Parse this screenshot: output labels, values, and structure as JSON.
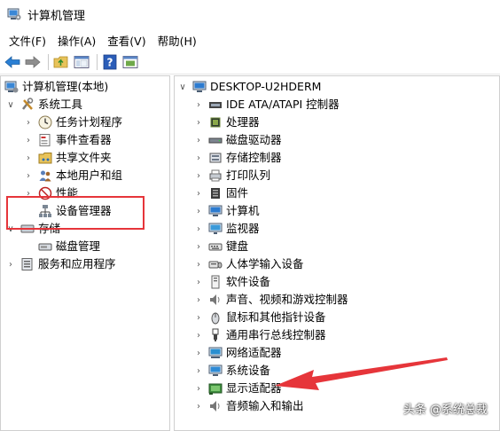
{
  "window": {
    "title": "计算机管理"
  },
  "menu": [
    "文件(F)",
    "操作(A)",
    "查看(V)",
    "帮助(H)"
  ],
  "toolbar": {
    "icons": [
      "back-arrow-icon",
      "forward-arrow-icon",
      "up-folder-icon",
      "show-hide-tree-icon",
      "help-icon",
      "properties-icon"
    ]
  },
  "left_tree": {
    "root": "计算机管理(本地)",
    "system_tools": "系统工具",
    "task_scheduler": "任务计划程序",
    "event_viewer": "事件查看器",
    "shared_folders": "共享文件夹",
    "local_users": "本地用户和组",
    "performance": "性能",
    "device_manager": "设备管理器",
    "storage": "存储",
    "disk_management": "磁盘管理",
    "services_apps": "服务和应用程序"
  },
  "right_tree": {
    "computer_name": "DESKTOP-U2HDERM",
    "categories": [
      "IDE ATA/ATAPI 控制器",
      "处理器",
      "磁盘驱动器",
      "存储控制器",
      "打印队列",
      "固件",
      "计算机",
      "监视器",
      "键盘",
      "人体学输入设备",
      "软件设备",
      "声音、视频和游戏控制器",
      "鼠标和其他指针设备",
      "通用串行总线控制器",
      "网络适配器",
      "系统设备",
      "显示适配器",
      "音频输入和输出"
    ]
  },
  "watermark": "头条 @系统总裁",
  "colors": {
    "highlight": "#e6353a",
    "arrow": "#e6353a"
  }
}
